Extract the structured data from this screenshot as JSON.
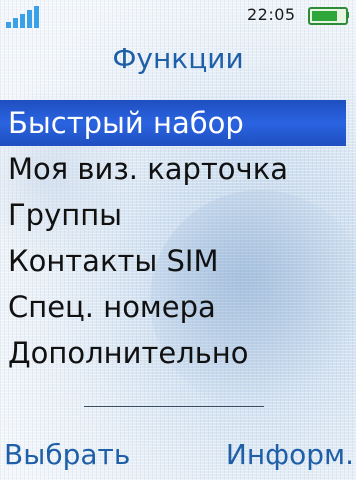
{
  "status_bar": {
    "time": "22:05",
    "signal_icon": "signal-strength-icon",
    "battery_icon": "battery-icon",
    "battery_level": 0.9,
    "accent_color": "#3aa0e8",
    "battery_color": "#2ea63a"
  },
  "screen": {
    "title": "Функции"
  },
  "menu": {
    "selected_index": 0,
    "highlight_color": "#2a63e0",
    "items": [
      {
        "label": "Быстрый набор"
      },
      {
        "label": "Моя виз. карточка"
      },
      {
        "label": "Группы"
      },
      {
        "label": "Контакты SIM"
      },
      {
        "label": "Спец. номера"
      },
      {
        "label": "Дополнительно"
      }
    ]
  },
  "softkeys": {
    "left": "Выбрать",
    "right": "Информ."
  }
}
